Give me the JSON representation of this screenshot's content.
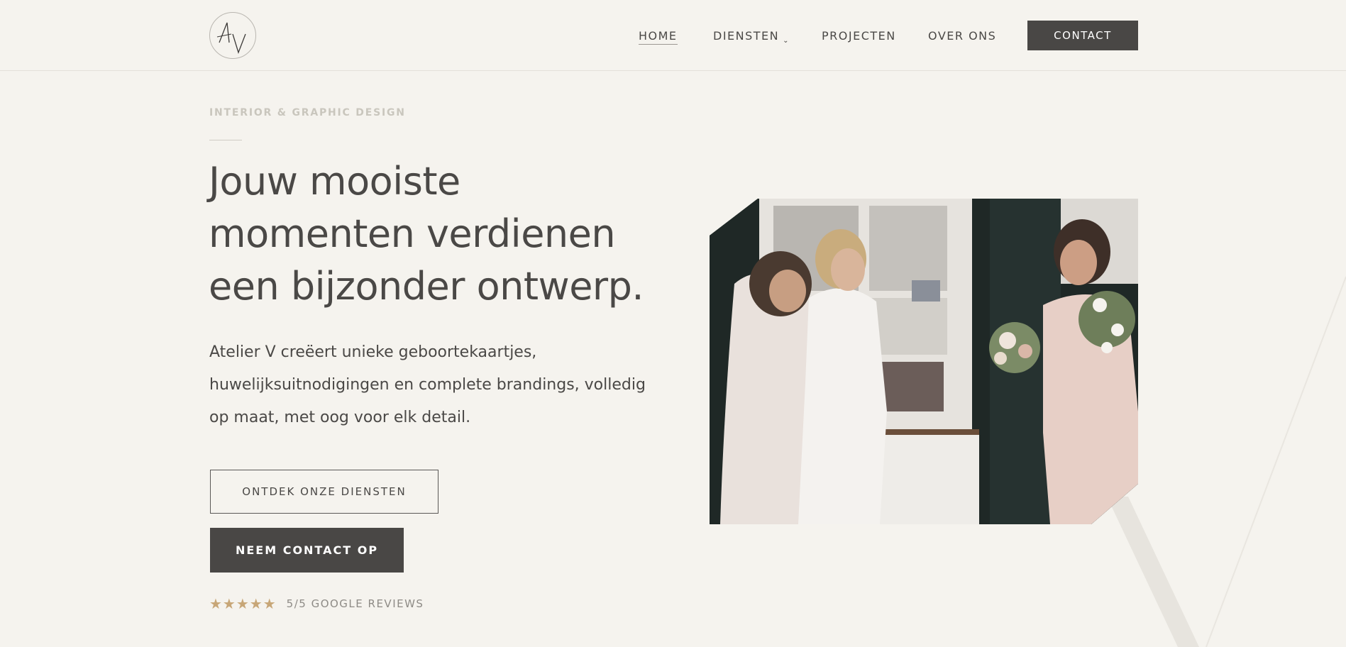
{
  "brand": {
    "logo_text": "AV"
  },
  "nav": {
    "items": [
      {
        "label": "HOME",
        "active": true
      },
      {
        "label": "DIENSTEN",
        "dropdown_indicator": "⌄"
      },
      {
        "label": "PROJECTEN"
      },
      {
        "label": "OVER ONS"
      }
    ],
    "contact_label": "CONTACT"
  },
  "hero": {
    "eyebrow": "INTERIOR & GRAPHIC DESIGN",
    "headline_lines": [
      "Jouw mooiste",
      "momenten verdienen",
      "een bijzonder ontwerp."
    ],
    "intro_lines": [
      "Atelier V creëert unieke geboortekaartjes,",
      "huwelijksuitnodigingen en complete brandings, volledig",
      "op maat, met oog voor elk detail."
    ],
    "primary_cta": "ONTDEK ONZE DIENSTEN",
    "secondary_cta": "NEEM CONTACT OP",
    "rating_stars": 5,
    "rating_text": "5/5 GOOGLE REVIEWS"
  },
  "colors": {
    "background": "#f5f3ee",
    "text": "#4a4846",
    "button_dark": "#494745",
    "star": "#c7a677",
    "eyebrow": "#c9c6bd"
  }
}
